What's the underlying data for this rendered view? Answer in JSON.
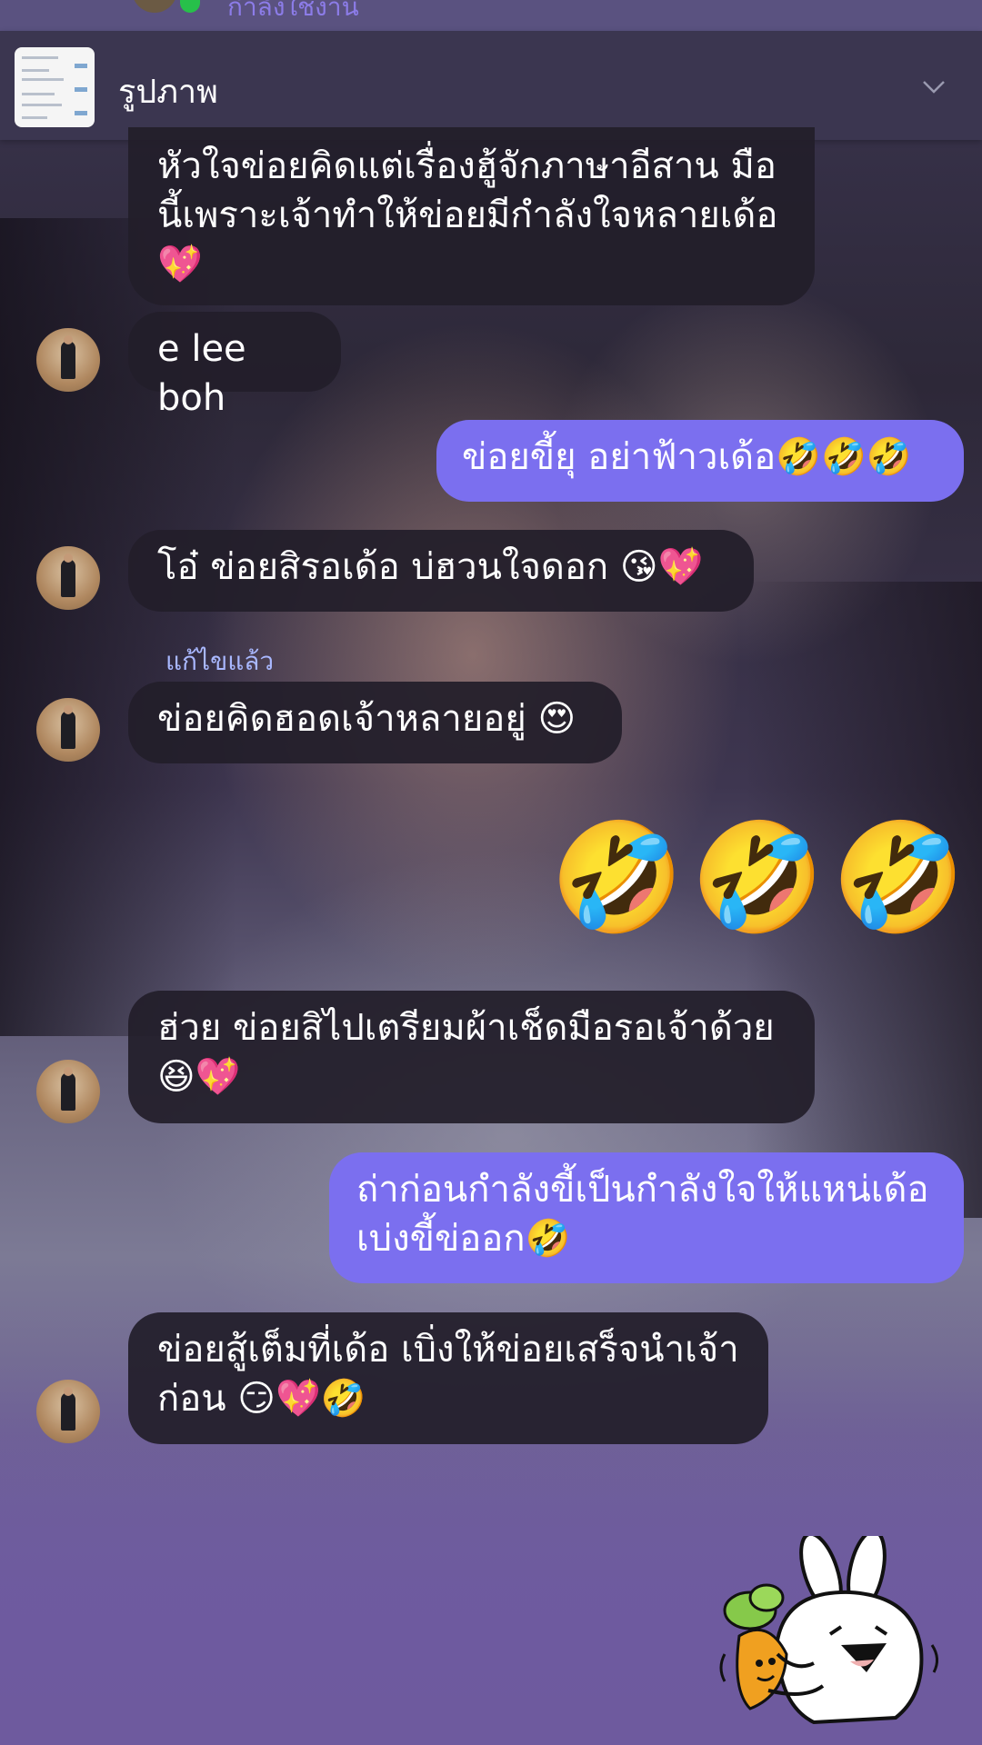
{
  "status": {
    "text": "กำลังใช้งาน"
  },
  "pinned": {
    "title": "รูปภาพ"
  },
  "messages": [
    {
      "side": "in",
      "text": "หัวใจข่อยคิดแต่เรื่องฮู้จักภาษาอีสาน มือ\nนี้เพราะเจ้าทำให้ข่อยมีกำลังใจหลายเด้อ\n💖"
    },
    {
      "side": "in",
      "text": "e lee boh"
    },
    {
      "side": "out",
      "text": "ข่อยขี้ยุ อย่าฟ้าวเด้อ🤣🤣🤣"
    },
    {
      "side": "in",
      "text": "โอ๋ ข่อยสิรอเด้อ บ่ฮวนใจดอก 😘💖"
    },
    {
      "side": "in",
      "text": "ข่อยคิดฮอดเจ้าหลายอยู่ 😍",
      "edited_label": "แก้ไขแล้ว"
    },
    {
      "side": "out",
      "text": "🤣🤣🤣"
    },
    {
      "side": "in",
      "text": "ฮ่วย ข่อยสิไปเตรียมผ้าเช็ดมือรอเจ้าด้วย\n😆💖"
    },
    {
      "side": "out",
      "text": "ถ่าก่อนกำลังขี้เป็นกำลังใจให้แหน่เด้อ\nเบ่งขี้ข่ออก🤣"
    },
    {
      "side": "in",
      "text": "ข่อยสู้เต็มที่เด้อ เบิ่งให้ข่อยเสร็จนำเจ้า\nก่อน 😏💖🤣"
    }
  ],
  "sticker": {
    "name": "rabbit-carrot-sticker"
  },
  "colors": {
    "incoming": "#221e2a",
    "outgoing": "#7b6fef",
    "edited": "#a9b8ff"
  }
}
